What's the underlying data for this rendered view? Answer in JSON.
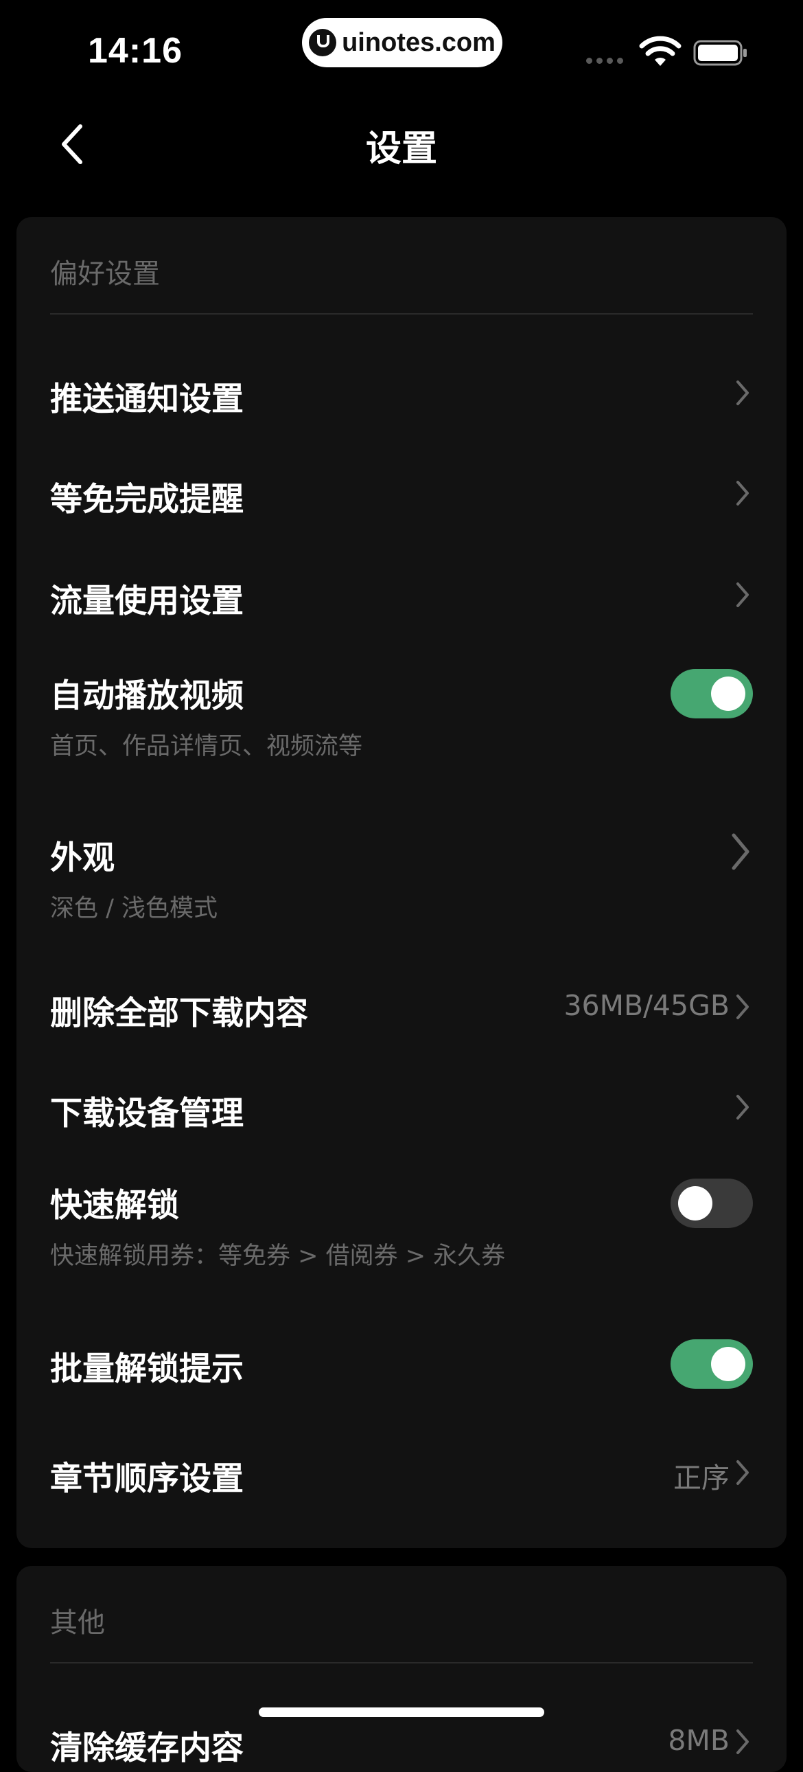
{
  "status_bar": {
    "time": "14:16",
    "watermark": "uinotes.com"
  },
  "nav": {
    "title": "设置"
  },
  "preferences": {
    "header": "偏好设置",
    "push_notifications": {
      "label": "推送通知设置"
    },
    "wait_free_reminder": {
      "label": "等免完成提醒"
    },
    "data_usage": {
      "label": "流量使用设置"
    },
    "autoplay_video": {
      "label": "自动播放视频",
      "subtitle": "首页、作品详情页、视频流等",
      "enabled": true
    },
    "appearance": {
      "label": "外观",
      "subtitle": "深色 / 浅色模式"
    },
    "delete_downloads": {
      "label": "删除全部下载内容",
      "value": "36MB/45GB"
    },
    "download_devices": {
      "label": "下载设备管理"
    },
    "quick_unlock": {
      "label": "快速解锁",
      "subtitle": "快速解锁用券：等免券 > 借阅券 > 永久券",
      "enabled": false
    },
    "batch_unlock_tip": {
      "label": "批量解锁提示",
      "enabled": true
    },
    "chapter_order": {
      "label": "章节顺序设置",
      "value": "正序"
    }
  },
  "other": {
    "header": "其他",
    "clear_cache": {
      "label": "清除缓存内容",
      "value": "8MB"
    }
  },
  "colors": {
    "background": "#000000",
    "card": "#121212",
    "toggle_on": "#46a771",
    "toggle_off": "#3a3a3a",
    "secondary_text": "#6a6a6a"
  }
}
